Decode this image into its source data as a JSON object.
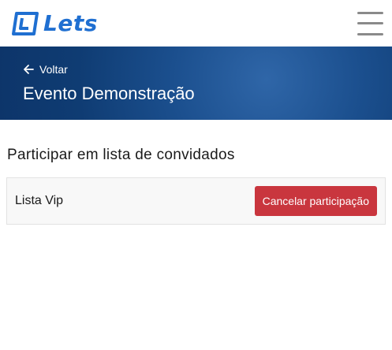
{
  "header": {
    "logo_text": "Lets",
    "menu_icon": "hamburger-menu-icon",
    "brand_color": "#1f6fd1"
  },
  "hero": {
    "back_label": "Voltar",
    "back_icon": "arrow-left-icon",
    "event_title": "Evento Demonstração",
    "background_color": "#0f3c73"
  },
  "main": {
    "section_title": "Participar em lista de convidados",
    "lists": [
      {
        "name": "Lista Vip",
        "action_label": "Cancelar participação",
        "action_color": "#c9363e"
      }
    ]
  }
}
